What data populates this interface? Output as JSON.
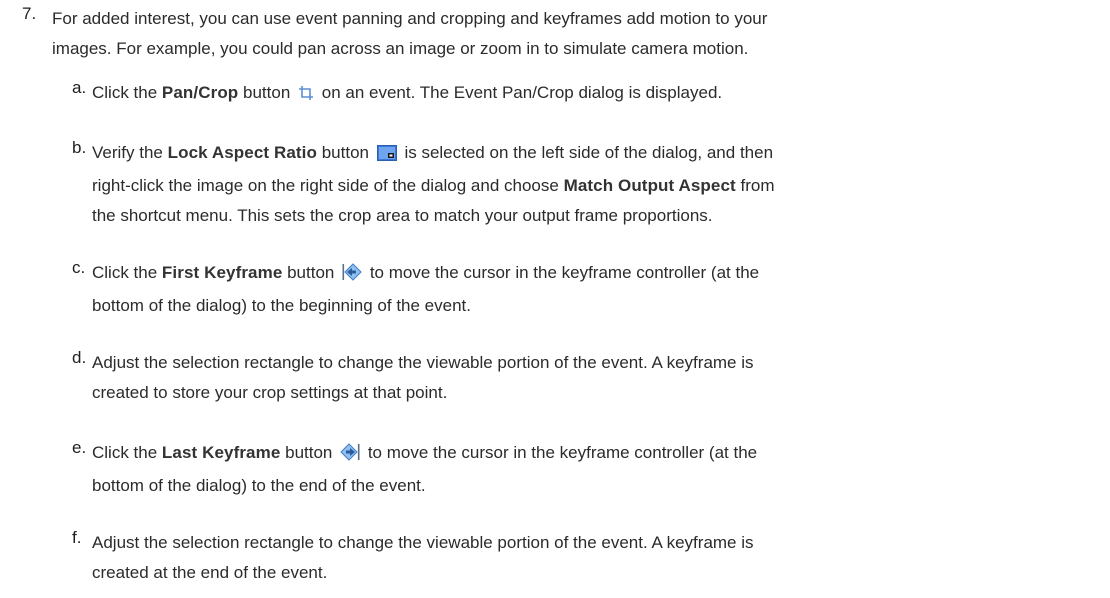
{
  "step7": {
    "number": "7.",
    "line1": "For added interest, you can use event panning and cropping and keyframes add motion to your",
    "line2": "images. For example, you could pan across an image or zoom in to simulate camera motion."
  },
  "substeps": {
    "a": {
      "letter": "a.",
      "pre": "Click the ",
      "ui": "Pan/Crop",
      "mid": " button ",
      "post": " on an event. The Event Pan/Crop dialog is displayed."
    },
    "b": {
      "letter": "b.",
      "pre": "Verify the ",
      "ui1": "Lock Aspect Ratio",
      "mid1": " button ",
      "mid2": " is selected on the left side of the dialog, and then",
      "line2_pre": "right-click the image on the right side of the dialog and choose ",
      "ui2": "Match Output Aspect",
      "line2_post": " from",
      "line3": "the shortcut menu. This sets the crop area to match your output frame proportions."
    },
    "c": {
      "letter": "c.",
      "pre": "Click the ",
      "ui": "First Keyframe",
      "mid": " button ",
      "post": " to move the cursor in the keyframe controller (at the",
      "line2": "bottom of the dialog) to the beginning of the event."
    },
    "d": {
      "letter": "d.",
      "line1": "Adjust the selection rectangle to change the viewable portion of the event. A keyframe is",
      "line2": "created to store your crop settings at that point."
    },
    "e": {
      "letter": "e.",
      "pre": "Click the ",
      "ui": "Last Keyframe",
      "mid": " button ",
      "post": " to move the cursor in the keyframe controller (at the",
      "line2": "bottom of the dialog) to the end of the event."
    },
    "f": {
      "letter": "f.",
      "line1": "Adjust the selection rectangle to change the viewable portion of the event. A keyframe is",
      "line2": "created at the end of the event."
    }
  },
  "icons": {
    "pan_crop": "pan-crop-icon",
    "lock_aspect": "lock-aspect-ratio-icon",
    "first_keyframe": "first-keyframe-icon",
    "last_keyframe": "last-keyframe-icon"
  },
  "colors": {
    "text": "#2b2b2b",
    "icon_blue": "#4a7fc8",
    "icon_diamond": "#5aa0e0"
  }
}
